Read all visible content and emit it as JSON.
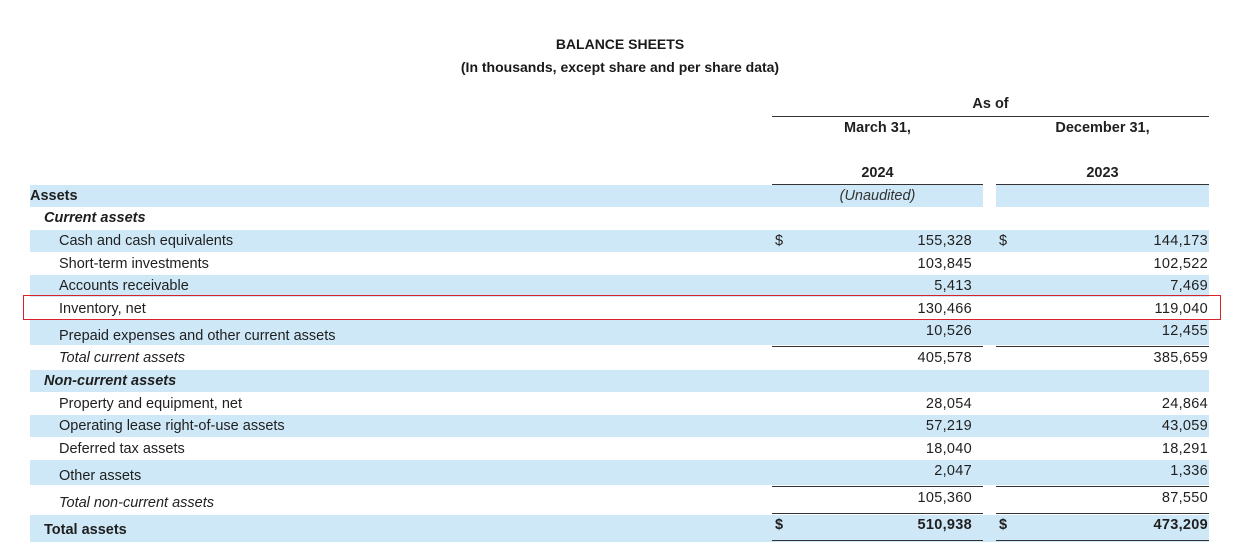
{
  "header": {
    "title": "BALANCE SHEETS",
    "subtitle": "(In thousands, except share and per share data)",
    "as_of": "As of",
    "col1_month": "March 31,",
    "col2_month": "December 31,",
    "col1_year": "2024",
    "col2_year": "2023",
    "col1_note": "(Unaudited)"
  },
  "sections": {
    "assets": "Assets",
    "current_assets": "Current assets",
    "non_current_assets": "Non-current assets"
  },
  "currency_symbol": "$",
  "rows": [
    {
      "label": "Cash and cash equivalents",
      "v2024": "155,328",
      "v2023": "144,173"
    },
    {
      "label": "Short-term investments",
      "v2024": "103,845",
      "v2023": "102,522"
    },
    {
      "label": "Accounts receivable",
      "v2024": "5,413",
      "v2023": "7,469"
    },
    {
      "label": "Inventory, net",
      "v2024": "130,466",
      "v2023": "119,040"
    },
    {
      "label": "Prepaid expenses and other current assets",
      "v2024": "10,526",
      "v2023": "12,455"
    },
    {
      "label": "Total current assets",
      "v2024": "405,578",
      "v2023": "385,659"
    },
    {
      "label": "Property and equipment, net",
      "v2024": "28,054",
      "v2023": "24,864"
    },
    {
      "label": "Operating lease right-of-use assets",
      "v2024": "57,219",
      "v2023": "43,059"
    },
    {
      "label": "Deferred tax assets",
      "v2024": "18,040",
      "v2023": "18,291"
    },
    {
      "label": "Other assets",
      "v2024": "2,047",
      "v2023": "1,336"
    },
    {
      "label": "Total non-current assets",
      "v2024": "105,360",
      "v2023": "87,550"
    },
    {
      "label": "Total assets",
      "v2024": "510,938",
      "v2023": "473,209"
    }
  ],
  "colors": {
    "band": "#cfe8f7",
    "highlight": "#d9232a"
  }
}
